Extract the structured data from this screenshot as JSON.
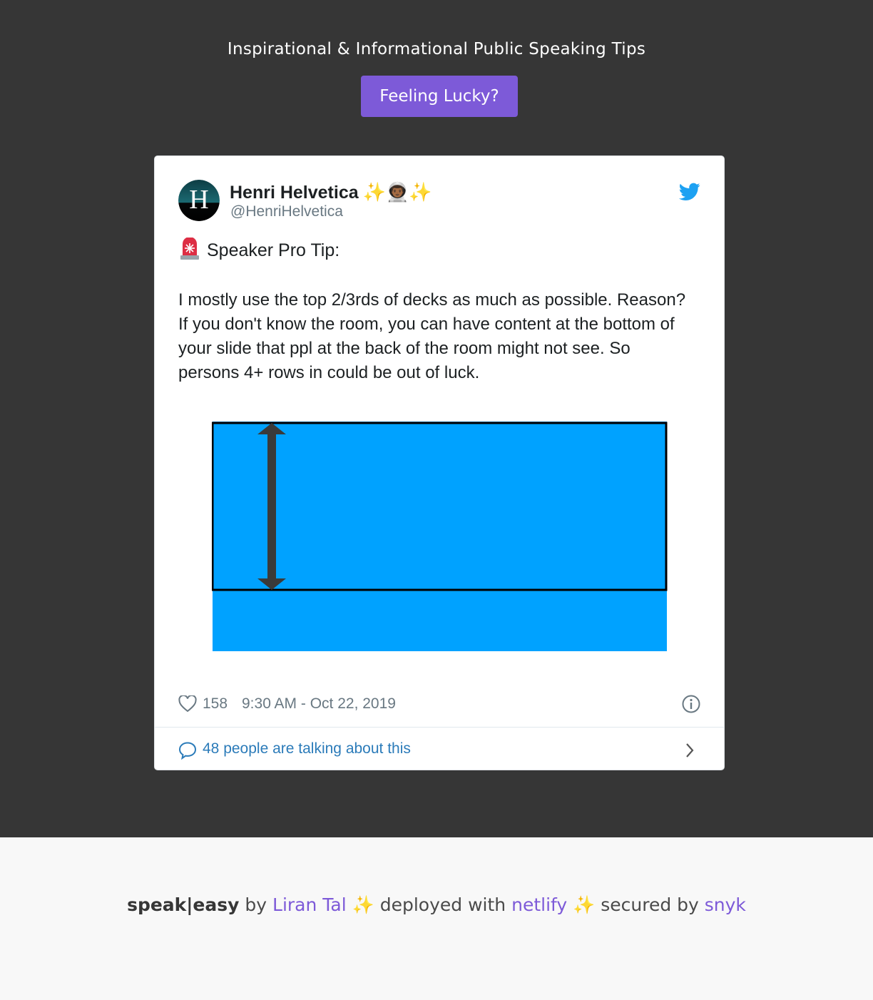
{
  "header": {
    "title": "Inspirational & Informational Public Speaking Tips",
    "lucky_label": "Feeling Lucky?"
  },
  "tweet": {
    "author_name": "Henri Helvetica",
    "author_decoration": "✨👨🏾‍🚀✨",
    "handle": "@HenriHelvetica",
    "avatar_letter": "H",
    "lead": "Speaker Pro Tip:",
    "body": "I mostly use the top 2/3rds of decks as much as possible. Reason? If you don't know the room, you can have content at the bottom of your slide that ppl at the back of the room might not see. So persons 4+ rows in could be out of luck.",
    "likes": "158",
    "timestamp": "9:30 AM - Oct 22, 2019",
    "conversation": "48 people are talking about this",
    "colors": {
      "slide_blue": "#00a2ff",
      "link_blue": "#2b7bb9",
      "twitter_blue": "#1da1f2"
    }
  },
  "footer": {
    "brand": "speak|easy",
    "by": "by",
    "author": "Liran Tal",
    "sparkle": "✨",
    "deployed": "deployed with",
    "host": "netlify",
    "secured": "secured by",
    "security": "snyk",
    "accent": "#7d5ad8"
  }
}
